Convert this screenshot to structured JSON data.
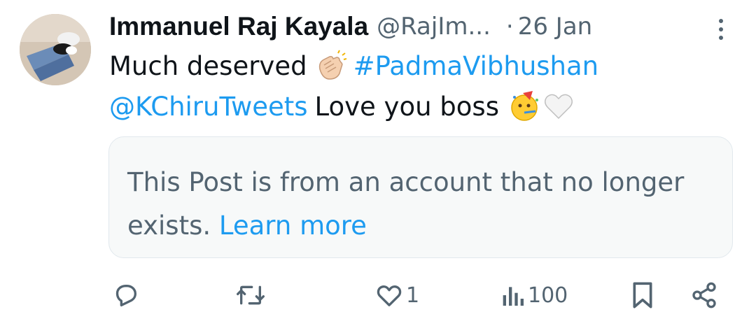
{
  "post": {
    "author_name": "Immanuel Raj Kayala",
    "handle": "@RajIm...",
    "separator": "·",
    "time": "26 Jan",
    "text_part1": "Much deserved",
    "hashtag": "#PadmaVibhushan",
    "mention": "@KChiruTweets",
    "text_part2": "Love you boss"
  },
  "notice": {
    "message": "This Post is from an account that no longer exists.",
    "link_label": "Learn more"
  },
  "actions": {
    "likes": "1",
    "views": "100"
  },
  "icons": {
    "more": "more-vertical-icon",
    "reply": "reply-icon",
    "repost": "repost-icon",
    "like": "heart-icon",
    "views": "views-icon",
    "bookmark": "bookmark-icon",
    "share": "share-icon",
    "emoji1": "clapping-hands-icon",
    "emoji2": "partying-face-icon",
    "emoji3": "white-heart-icon"
  },
  "colors": {
    "accent": "#1d9bf0",
    "secondary_text": "#536471",
    "notice_background": "#f7f9f9"
  }
}
